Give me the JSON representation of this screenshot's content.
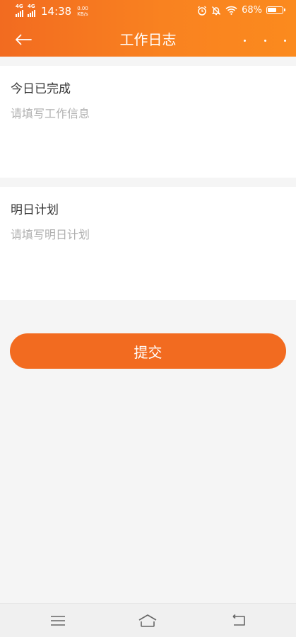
{
  "status_bar": {
    "network1": "4G",
    "network2": "4G",
    "time": "14:38",
    "speed_value": "0.00",
    "speed_unit": "KB/s",
    "battery_percent": "68%",
    "battery_level": 0.68
  },
  "header": {
    "title": "工作日志",
    "back_icon": "arrow-left-icon",
    "more_icon": "more-dots-icon",
    "gradient": [
      "#f26b20",
      "#fb8a1e"
    ]
  },
  "sections": [
    {
      "title": "今日已完成",
      "placeholder": "请填写工作信息",
      "value": ""
    },
    {
      "title": "明日计划",
      "placeholder": "请填写明日计划",
      "value": ""
    }
  ],
  "submit": {
    "label": "提交",
    "color": "#f26b20"
  },
  "system_nav": {
    "menu_icon": "menu-icon",
    "home_icon": "home-icon",
    "back_icon": "back-icon"
  }
}
